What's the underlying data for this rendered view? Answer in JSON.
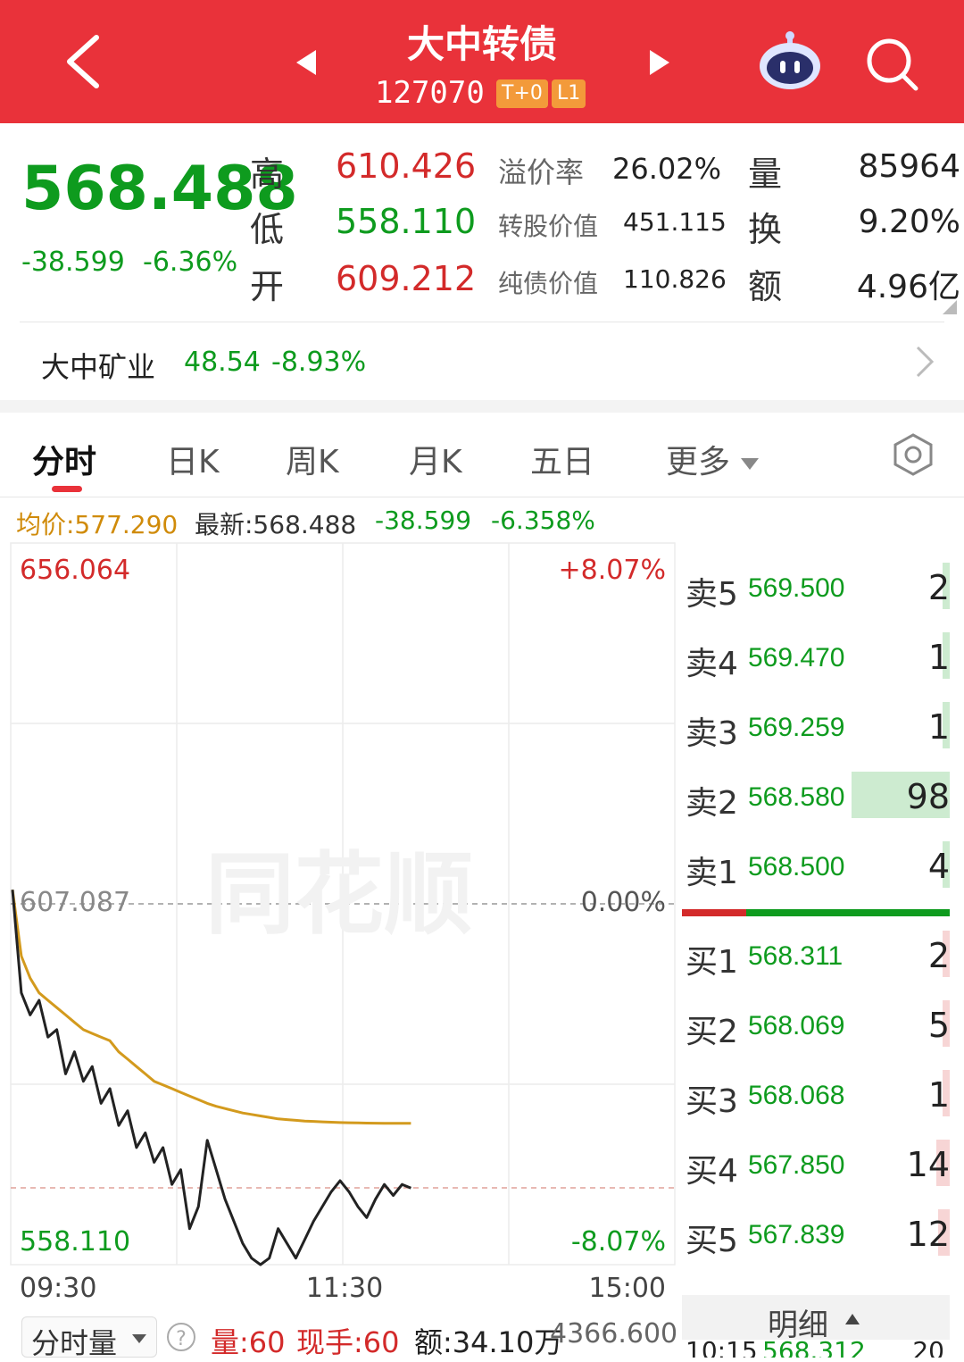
{
  "header": {
    "title": "大中转债",
    "code": "127070",
    "badge1": "T+0",
    "badge2": "L1"
  },
  "quote": {
    "price": "568.488",
    "change": "-38.599",
    "change_pct": "-6.36%",
    "high_label": "高",
    "high": "610.426",
    "low_label": "低",
    "low": "558.110",
    "open_label": "开",
    "open": "609.212",
    "premium_label": "溢价率",
    "premium": "26.02%",
    "conv_value_label": "转股价值",
    "conv_value": "451.115",
    "bond_value_label": "纯债价值",
    "bond_value": "110.826",
    "volume_label": "量",
    "volume": "85964",
    "turnover_label": "换",
    "turnover": "9.20%",
    "amount_label": "额",
    "amount": "4.96亿"
  },
  "underlying": {
    "name": "大中矿业",
    "price": "48.54",
    "change_pct": "-8.93%"
  },
  "tabs": [
    "分时",
    "日K",
    "周K",
    "月K",
    "五日",
    "更多"
  ],
  "info": {
    "avg": "均价:577.290",
    "latest": "最新:568.488",
    "chg": "-38.599",
    "pct": "-6.358%"
  },
  "chart": {
    "top_price": "656.064",
    "mid_price": "607.087",
    "bottom_price": "558.110",
    "top_pct": "+8.07%",
    "mid_pct": "0.00%",
    "bottom_pct": "-8.07%",
    "t_start": "09:30",
    "t_mid": "11:30",
    "t_end": "15:00",
    "watermark": "同花顺"
  },
  "chart_data": {
    "type": "line",
    "ylim": [
      558.11,
      656.064
    ],
    "x": [
      "09:30",
      "09:31",
      "09:32",
      "09:33",
      "09:34",
      "09:35",
      "09:36",
      "09:37",
      "09:38",
      "09:39",
      "09:40",
      "09:41",
      "09:42",
      "09:43",
      "09:44",
      "09:45",
      "09:46",
      "09:47",
      "09:48",
      "09:49",
      "09:50",
      "09:51",
      "09:52",
      "09:53",
      "09:54",
      "09:55",
      "09:56",
      "09:57",
      "09:58",
      "09:59",
      "10:00",
      "10:01",
      "10:02",
      "10:03",
      "10:04",
      "10:05",
      "10:06",
      "10:07",
      "10:08",
      "10:09",
      "10:10",
      "10:11",
      "10:12",
      "10:13",
      "10:14",
      "10:15"
    ],
    "series": [
      {
        "name": "price",
        "color": "#222222",
        "values": [
          609.0,
          595.0,
          592.0,
          594.0,
          589.0,
          590.0,
          584.0,
          587.0,
          583.0,
          585.0,
          580.0,
          582.0,
          577.0,
          579.0,
          574.0,
          576.0,
          572.0,
          574.0,
          569.0,
          571.0,
          563.0,
          566.0,
          575.0,
          571.0,
          567.0,
          564.0,
          561.0,
          559.0,
          558.11,
          559.0,
          563.0,
          561.0,
          559.0,
          561.5,
          564.0,
          566.0,
          568.0,
          569.5,
          568.0,
          566.0,
          564.5,
          567.0,
          569.0,
          567.5,
          569.0,
          568.5
        ]
      },
      {
        "name": "均价",
        "color": "#d39a1d",
        "values": [
          609.0,
          600.0,
          597.0,
          595.0,
          594.0,
          593.0,
          592.0,
          591.0,
          590.0,
          589.5,
          589.0,
          588.5,
          587.0,
          586.0,
          585.0,
          584.0,
          583.0,
          582.5,
          582.0,
          581.5,
          581.0,
          580.5,
          580.0,
          579.6,
          579.3,
          579.0,
          578.7,
          578.5,
          578.3,
          578.1,
          577.9,
          577.8,
          577.7,
          577.6,
          577.55,
          577.5,
          577.45,
          577.4,
          577.37,
          577.35,
          577.33,
          577.31,
          577.3,
          577.3,
          577.29,
          577.29
        ]
      }
    ]
  },
  "orderbook": {
    "asks": [
      {
        "label": "卖5",
        "price": "569.500",
        "vol": "2",
        "bar": 0.02
      },
      {
        "label": "卖4",
        "price": "569.470",
        "vol": "1",
        "bar": 0.01
      },
      {
        "label": "卖3",
        "price": "569.259",
        "vol": "1",
        "bar": 0.01
      },
      {
        "label": "卖2",
        "price": "568.580",
        "vol": "98",
        "bar": 1.0
      },
      {
        "label": "卖1",
        "price": "568.500",
        "vol": "4",
        "bar": 0.04
      }
    ],
    "bids": [
      {
        "label": "买1",
        "price": "568.311",
        "vol": "2",
        "bar": 0.02
      },
      {
        "label": "买2",
        "price": "568.069",
        "vol": "5",
        "bar": 0.05
      },
      {
        "label": "买3",
        "price": "568.068",
        "vol": "1",
        "bar": 0.01
      },
      {
        "label": "买4",
        "price": "567.850",
        "vol": "14",
        "bar": 0.14
      },
      {
        "label": "买5",
        "price": "567.839",
        "vol": "12",
        "bar": 0.12
      }
    ],
    "detail_label": "明细",
    "detail_first": {
      "time": "10:15",
      "price": "568.312",
      "vol": "20"
    }
  },
  "bottom": {
    "sel": "分时量",
    "vol": "量:60",
    "now": "现手:60",
    "amt": "额:34.10万",
    "max": "4366.600"
  },
  "colors": {
    "header_bg": "#e9323a",
    "up": "#d32a2a",
    "down": "#0e9b1e",
    "avg": "#d39a1d"
  }
}
